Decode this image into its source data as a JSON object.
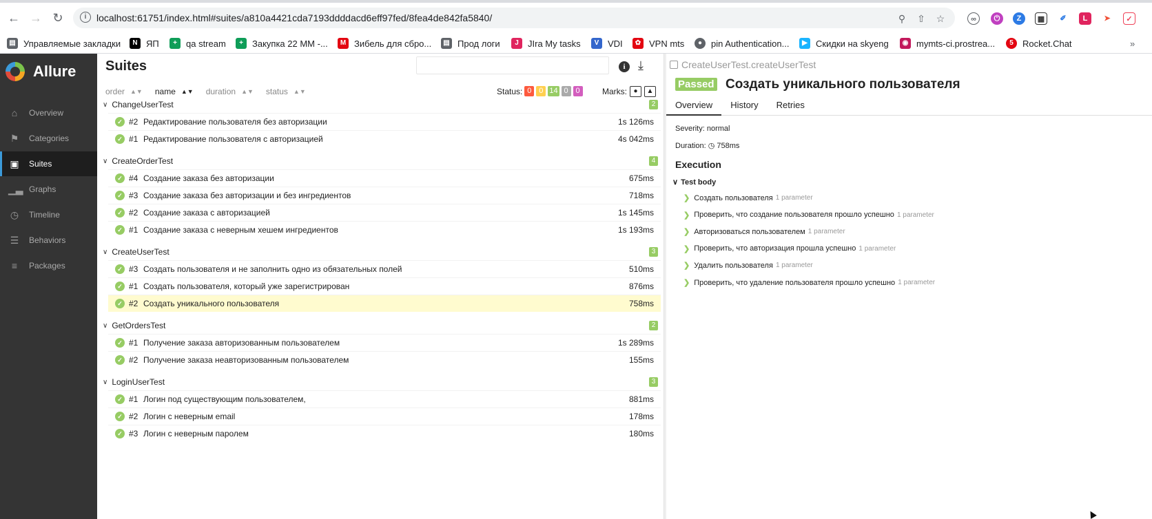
{
  "browser": {
    "url": "localhost:61751/index.html#suites/a810a4421cda7193ddddacd6eff97fed/8fea4de842fa5840/",
    "bookmarks": [
      {
        "label": "Управляемые закладки",
        "icon": "folder-icon",
        "color": "#5f6368"
      },
      {
        "label": "ЯП",
        "icon": "notion-icon",
        "color": "#000000"
      },
      {
        "label": "qa stream",
        "icon": "sheets-icon",
        "color": "#0f9d58"
      },
      {
        "label": "Закупка 22 ММ -...",
        "icon": "sheets-icon",
        "color": "#0f9d58"
      },
      {
        "label": "Зибель для сбро...",
        "icon": "mts-icon",
        "color": "#e30611"
      },
      {
        "label": "Прод логи",
        "icon": "folder-icon",
        "color": "#5f6368"
      },
      {
        "label": "JIra My tasks",
        "icon": "jira-icon",
        "color": "#e0245e"
      },
      {
        "label": "VDI",
        "icon": "vdi-icon",
        "color": "#3366cc"
      },
      {
        "label": "VPN mts",
        "icon": "vpn-icon",
        "color": "#e30611"
      },
      {
        "label": "pin Authentication...",
        "icon": "globe-icon",
        "color": "#5f6368"
      },
      {
        "label": "Скидки на skyeng",
        "icon": "skyeng-icon",
        "color": "#1ab4ff"
      },
      {
        "label": "mymts-ci.prostrea...",
        "icon": "octopus-icon",
        "color": "#c2185b"
      },
      {
        "label": "Rocket.Chat",
        "icon": "rocket-chat-icon",
        "color": "#e30611"
      }
    ]
  },
  "sidebar": {
    "brand": "Allure",
    "items": [
      {
        "label": "Overview",
        "icon": "home-icon"
      },
      {
        "label": "Categories",
        "icon": "flag-icon"
      },
      {
        "label": "Suites",
        "icon": "briefcase-icon",
        "active": true
      },
      {
        "label": "Graphs",
        "icon": "bar-chart-icon"
      },
      {
        "label": "Timeline",
        "icon": "clock-icon"
      },
      {
        "label": "Behaviors",
        "icon": "list-icon"
      },
      {
        "label": "Packages",
        "icon": "align-left-icon"
      }
    ]
  },
  "suites": {
    "title": "Suites",
    "sort": [
      "order",
      "name",
      "duration",
      "status"
    ],
    "status_label": "Status:",
    "status_counts": [
      {
        "value": "0",
        "color": "#fd5a3e"
      },
      {
        "value": "0",
        "color": "#ffd050"
      },
      {
        "value": "14",
        "color": "#97cc64"
      },
      {
        "value": "0",
        "color": "#aaaaaa"
      },
      {
        "value": "0",
        "color": "#d35ebe"
      }
    ],
    "marks_label": "Marks:",
    "groups": [
      {
        "name": "ChangeUserTest",
        "count": "2",
        "rows": [
          {
            "num": "#2",
            "name": "Редактирование пользователя без авторизации",
            "duration": "1s 126ms"
          },
          {
            "num": "#1",
            "name": "Редактирование пользователя с авторизацией",
            "duration": "4s 042ms"
          }
        ]
      },
      {
        "name": "CreateOrderTest",
        "count": "4",
        "rows": [
          {
            "num": "#4",
            "name": "Создание заказа без авторизации",
            "duration": "675ms"
          },
          {
            "num": "#3",
            "name": "Создание заказа без авторизации и без ингредиентов",
            "duration": "718ms"
          },
          {
            "num": "#2",
            "name": "Создание заказа с авторизацией",
            "duration": "1s 145ms"
          },
          {
            "num": "#1",
            "name": "Создание заказа с неверным хешем ингредиентов",
            "duration": "1s 193ms"
          }
        ]
      },
      {
        "name": "CreateUserTest",
        "count": "3",
        "rows": [
          {
            "num": "#3",
            "name": "Создать пользователя и не заполнить одно из обязательных полей",
            "duration": "510ms"
          },
          {
            "num": "#1",
            "name": "Создать пользователя, который уже зарегистрирован",
            "duration": "876ms"
          },
          {
            "num": "#2",
            "name": "Создать уникального пользователя",
            "duration": "758ms",
            "selected": true
          }
        ]
      },
      {
        "name": "GetOrdersTest",
        "count": "2",
        "rows": [
          {
            "num": "#1",
            "name": "Получение заказа авторизованным пользователем",
            "duration": "1s 289ms"
          },
          {
            "num": "#2",
            "name": "Получение заказа неавторизованным пользователем",
            "duration": "155ms"
          }
        ]
      },
      {
        "name": "LoginUserTest",
        "count": "3",
        "rows": [
          {
            "num": "#1",
            "name": "Логин под существующим пользователем,",
            "duration": "881ms"
          },
          {
            "num": "#2",
            "name": "Логин с неверным email",
            "duration": "178ms"
          },
          {
            "num": "#3",
            "name": "Логин с неверным паролем",
            "duration": "180ms"
          }
        ]
      }
    ]
  },
  "detail": {
    "breadcrumb": "CreateUserTest.createUserTest",
    "status": "Passed",
    "title": "Создать уникального пользователя",
    "tabs": [
      "Overview",
      "History",
      "Retries"
    ],
    "severity": "Severity: normal",
    "duration_label": "Duration:",
    "duration": "758ms",
    "execution": "Execution",
    "test_body": "Test body",
    "steps": [
      {
        "name": "Создать пользователя",
        "param": "1 parameter"
      },
      {
        "name": "Проверить, что создание пользователя прошло успешно",
        "param": "1 parameter"
      },
      {
        "name": "Авторизоваться пользователем",
        "param": "1 parameter"
      },
      {
        "name": "Проверить, что авторизация прошла успешно",
        "param": "1 parameter"
      },
      {
        "name": "Удалить пользователя",
        "param": "1 parameter"
      },
      {
        "name": "Проверить, что удаление пользователя прошло успешно",
        "param": "1 parameter"
      }
    ]
  }
}
